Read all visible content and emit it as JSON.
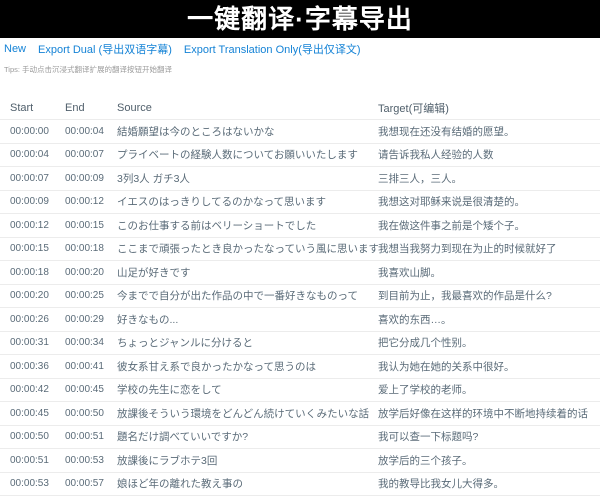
{
  "banner": {
    "title": "一键翻译·字幕导出"
  },
  "menu": {
    "items": [
      {
        "label": "New"
      },
      {
        "label": "Export Dual (导出双语字幕)"
      },
      {
        "label": "Export Translation Only(导出仅译文)"
      }
    ]
  },
  "tips": "Tips: 手动点击沉浸式翻译扩展的翻译按钮开始翻译",
  "table": {
    "columns": [
      "Start",
      "End",
      "Source",
      "Target(可编辑)"
    ],
    "rows": [
      {
        "start": "00:00:00",
        "end": "00:00:04",
        "source": "結婚願望は今のところはないかな",
        "target": "我想现在还没有结婚的愿望。"
      },
      {
        "start": "00:00:04",
        "end": "00:00:07",
        "source": "プライベートの経験人数についてお願いいたします",
        "target": "请告诉我私人经验的人数"
      },
      {
        "start": "00:00:07",
        "end": "00:00:09",
        "source": "3列3人 ガチ3人",
        "target": "三排三人，三人。"
      },
      {
        "start": "00:00:09",
        "end": "00:00:12",
        "source": "イエスのはっきりしてるのかなって思います",
        "target": "我想这对耶稣来说是很清楚的。"
      },
      {
        "start": "00:00:12",
        "end": "00:00:15",
        "source": "このお仕事する前はベリーショートでした",
        "target": "我在做这件事之前是个矮个子。"
      },
      {
        "start": "00:00:15",
        "end": "00:00:18",
        "source": "ここまで頑張ったとき良かったなっていう風に思います",
        "target": "我想当我努力到现在为止的时候就好了"
      },
      {
        "start": "00:00:18",
        "end": "00:00:20",
        "source": "山足が好きです",
        "target": "我喜欢山脚。"
      },
      {
        "start": "00:00:20",
        "end": "00:00:25",
        "source": "今までで自分が出た作品の中で一番好きなものって",
        "target": "到目前为止，我最喜欢的作品是什么?"
      },
      {
        "start": "00:00:26",
        "end": "00:00:29",
        "source": "好きなもの...",
        "target": "喜欢的东西…。"
      },
      {
        "start": "00:00:31",
        "end": "00:00:34",
        "source": "ちょっとジャンルに分けると",
        "target": "把它分成几个性别。"
      },
      {
        "start": "00:00:36",
        "end": "00:00:41",
        "source": "彼女系甘え系で良かったかなって思うのは",
        "target": "我认为她在她的关系中很好。"
      },
      {
        "start": "00:00:42",
        "end": "00:00:45",
        "source": "学校の先生に恋をして",
        "target": "爱上了学校的老师。"
      },
      {
        "start": "00:00:45",
        "end": "00:00:50",
        "source": "放課後そういう環境をどんどん続けていくみたいな話",
        "target": "放学后好像在这样的环境中不断地持续着的话"
      },
      {
        "start": "00:00:50",
        "end": "00:00:51",
        "source": "題名だけ調べていいですか?",
        "target": "我可以查一下标题吗?"
      },
      {
        "start": "00:00:51",
        "end": "00:00:53",
        "source": "放課後にラブホテ3回",
        "target": "放学后的三个孩子。"
      },
      {
        "start": "00:00:53",
        "end": "00:00:57",
        "source": "娘ほど年の離れた教え事の",
        "target": "我的教导比我女儿大得多。"
      }
    ]
  },
  "colors": {
    "banner_bg": "#000000",
    "banner_text": "#ffffff",
    "link_blue": "#1583d6",
    "table_text": "#5a6b78",
    "tips_gray": "#9b9b9b",
    "divider": "#ececec"
  }
}
